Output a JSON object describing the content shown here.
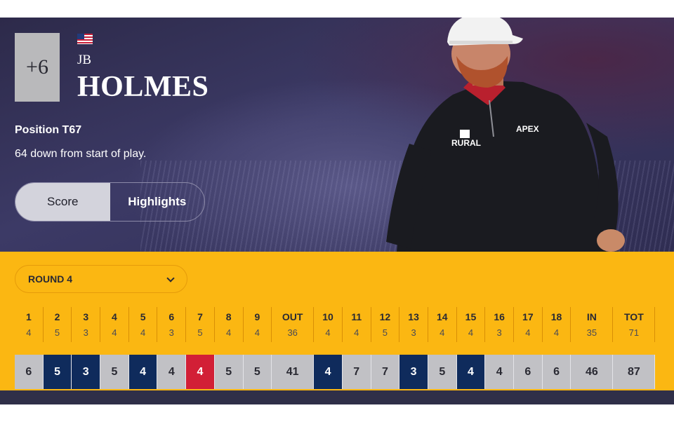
{
  "player": {
    "total_to_par": "+6",
    "first_name": "JB",
    "last_name": "HOLMES",
    "position": "Position T67",
    "movement": "64 down from start of play."
  },
  "tabs": [
    {
      "label": "Score",
      "active": true
    },
    {
      "label": "Highlights",
      "active": false
    }
  ],
  "round_selector": {
    "selected": "ROUND 4"
  },
  "holes": [
    {
      "hole": "1",
      "par": "4",
      "score": "6",
      "type": "bogey"
    },
    {
      "hole": "2",
      "par": "5",
      "score": "5",
      "type": "par"
    },
    {
      "hole": "3",
      "par": "3",
      "score": "3",
      "type": "par"
    },
    {
      "hole": "4",
      "par": "4",
      "score": "5",
      "type": "bogey"
    },
    {
      "hole": "5",
      "par": "4",
      "score": "4",
      "type": "par"
    },
    {
      "hole": "6",
      "par": "3",
      "score": "4",
      "type": "bogey"
    },
    {
      "hole": "7",
      "par": "5",
      "score": "4",
      "type": "birdie"
    },
    {
      "hole": "8",
      "par": "4",
      "score": "5",
      "type": "bogey"
    },
    {
      "hole": "9",
      "par": "4",
      "score": "5",
      "type": "bogey"
    },
    {
      "hole": "OUT",
      "par": "36",
      "score": "41",
      "type": "total"
    },
    {
      "hole": "10",
      "par": "4",
      "score": "4",
      "type": "par"
    },
    {
      "hole": "11",
      "par": "4",
      "score": "7",
      "type": "bogey"
    },
    {
      "hole": "12",
      "par": "5",
      "score": "7",
      "type": "bogey"
    },
    {
      "hole": "13",
      "par": "3",
      "score": "3",
      "type": "par"
    },
    {
      "hole": "14",
      "par": "4",
      "score": "5",
      "type": "bogey"
    },
    {
      "hole": "15",
      "par": "4",
      "score": "4",
      "type": "par"
    },
    {
      "hole": "16",
      "par": "3",
      "score": "4",
      "type": "bogey"
    },
    {
      "hole": "17",
      "par": "4",
      "score": "6",
      "type": "bogey"
    },
    {
      "hole": "18",
      "par": "4",
      "score": "6",
      "type": "bogey"
    },
    {
      "hole": "IN",
      "par": "35",
      "score": "46",
      "type": "total"
    },
    {
      "hole": "TOT",
      "par": "71",
      "score": "87",
      "type": "total"
    }
  ],
  "colors": {
    "card_background": "#fbb712",
    "par_cell": "#c1c1c5",
    "par_highlight_cell": "#0f2b5c",
    "birdie_cell": "#d21f36",
    "hero_background": "#35335a"
  },
  "icons": {
    "flag": "us-flag-icon",
    "dropdown": "chevron-down-icon"
  },
  "brand": {
    "jumper_logo": "RURAL",
    "cap_logo": "APEX"
  }
}
